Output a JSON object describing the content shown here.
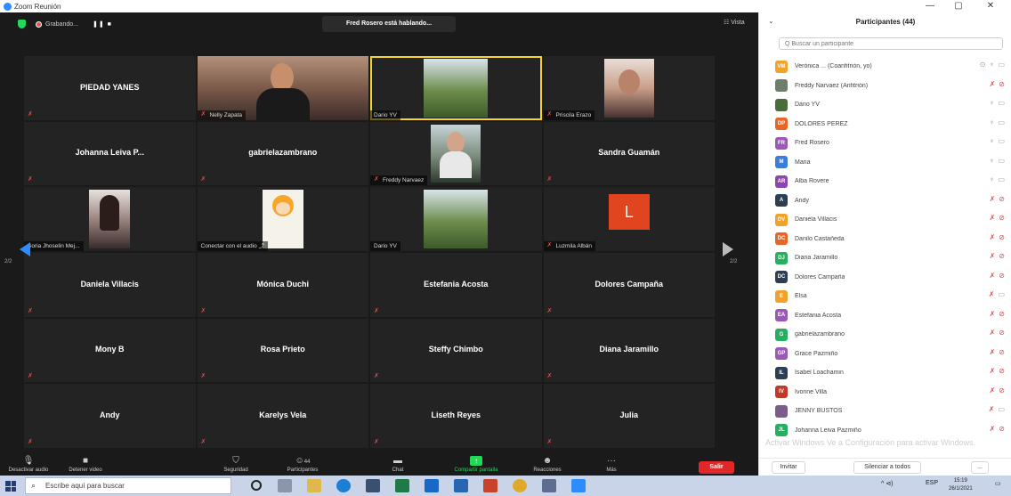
{
  "window": {
    "title": "Zoom Reunión",
    "minimize": "—",
    "maximize": "▢",
    "close": "✕"
  },
  "topbar": {
    "recording_label": "Grabando...",
    "recording_controls": "❚❚ ■",
    "speaking_banner": "Fred Rosero está hablando...",
    "view_label": "☷ Vista"
  },
  "tiles": [
    {
      "name_big": "PIEDAD YANES",
      "label": "",
      "muted": true,
      "video": ""
    },
    {
      "name_big": "",
      "label": "Nelly Zapata",
      "muted": true,
      "video": "nelly"
    },
    {
      "name_big": "",
      "label": "Dario YV",
      "muted": false,
      "video": "dario",
      "speaking": true
    },
    {
      "name_big": "",
      "label": "Priscila Erazo",
      "muted": true,
      "video": "priscila"
    },
    {
      "name_big": "Johanna Leiva P...",
      "label": "",
      "muted": true,
      "video": ""
    },
    {
      "name_big": "gabrielazambrano",
      "label": "",
      "muted": true,
      "video": ""
    },
    {
      "name_big": "",
      "label": "Freddy Narvaez",
      "muted": true,
      "video": "freddy"
    },
    {
      "name_big": "Sandra Guamán",
      "label": "",
      "muted": true,
      "video": ""
    },
    {
      "name_big": "",
      "label": "Soria Jhoselin Mej...",
      "muted": false,
      "video": "soria"
    },
    {
      "name_big": "",
      "label": "Conectar con el audio ⤴",
      "muted": false,
      "video": "naruto"
    },
    {
      "name_big": "",
      "label": "Dario YV",
      "muted": false,
      "video": "dario"
    },
    {
      "name_big": "",
      "label": "Luzmila Albán",
      "muted": true,
      "video": "avatar",
      "avatar_letter": "L"
    },
    {
      "name_big": "Daniela Villacis",
      "label": "",
      "muted": true,
      "video": ""
    },
    {
      "name_big": "Mónica Duchi",
      "label": "",
      "muted": true,
      "video": ""
    },
    {
      "name_big": "Estefania Acosta",
      "label": "",
      "muted": true,
      "video": ""
    },
    {
      "name_big": "Dolores Campaña",
      "label": "",
      "muted": true,
      "video": ""
    },
    {
      "name_big": "Mony B",
      "label": "",
      "muted": true,
      "video": ""
    },
    {
      "name_big": "Rosa Prieto",
      "label": "",
      "muted": true,
      "video": ""
    },
    {
      "name_big": "Steffy Chimbo",
      "label": "",
      "muted": true,
      "video": ""
    },
    {
      "name_big": "Diana Jaramillo",
      "label": "",
      "muted": true,
      "video": ""
    },
    {
      "name_big": "Andy",
      "label": "",
      "muted": true,
      "video": ""
    },
    {
      "name_big": "Karelys Vela",
      "label": "",
      "muted": true,
      "video": ""
    },
    {
      "name_big": "Liseth Reyes",
      "label": "",
      "muted": true,
      "video": ""
    },
    {
      "name_big": "Julia",
      "label": "",
      "muted": true,
      "video": ""
    }
  ],
  "pagination": {
    "left": "2/2",
    "right": "2/2"
  },
  "toolbar": {
    "mute_audio": "Desactivar audio",
    "stop_video": "Detener video",
    "security": "Seguridad",
    "participants": "Participantes",
    "participants_count": "44",
    "chat": "Chat",
    "share_screen": "Compartir pantalla",
    "reactions": "Reacciones",
    "more": "Más",
    "leave": "Salir"
  },
  "panel": {
    "collapse_icon": "⌄",
    "title": "Participantes (44)",
    "search_placeholder": "Q Buscar un participante",
    "participants": [
      {
        "initials": "VM",
        "color": "#f0a22a",
        "name": "Verónica ...  (Coanfitrión, yo)",
        "mic": "on",
        "cam": "on",
        "extra": "⊙"
      },
      {
        "initials": "",
        "color": "#6d7f6a",
        "name": "Freddy Narvaez (Anfitrión)",
        "mic": "muted",
        "cam": "off",
        "photo": true
      },
      {
        "initials": "",
        "color": "#4a6b3a",
        "name": "Dario YV",
        "mic": "on",
        "cam": "on",
        "photo": true
      },
      {
        "initials": "DP",
        "color": "#e8652a",
        "name": "DOLORES PEREZ",
        "mic": "on",
        "cam": "on"
      },
      {
        "initials": "FR",
        "color": "#9b59b6",
        "name": "Fred Rosero",
        "mic": "on",
        "cam": "on"
      },
      {
        "initials": "M",
        "color": "#3b7ddd",
        "name": "Maria",
        "mic": "on",
        "cam": "on"
      },
      {
        "initials": "AR",
        "color": "#8e44ad",
        "name": "Alba Rovere",
        "mic": "on",
        "cam": "on"
      },
      {
        "initials": "A",
        "color": "#2c3e50",
        "name": "Andy",
        "mic": "muted",
        "cam": "off"
      },
      {
        "initials": "DV",
        "color": "#f0a22a",
        "name": "Daniela Villacis",
        "mic": "muted",
        "cam": "off"
      },
      {
        "initials": "DC",
        "color": "#e8652a",
        "name": "Danilo Castañeda",
        "mic": "muted",
        "cam": "off"
      },
      {
        "initials": "DJ",
        "color": "#27ae60",
        "name": "Diana Jaramillo",
        "mic": "muted",
        "cam": "off"
      },
      {
        "initials": "DC",
        "color": "#2c3e50",
        "name": "Dolores Campaña",
        "mic": "muted",
        "cam": "off"
      },
      {
        "initials": "E",
        "color": "#f0a22a",
        "name": "Elsa",
        "mic": "muted",
        "cam": "on"
      },
      {
        "initials": "EA",
        "color": "#9b59b6",
        "name": "Estefania Acosta",
        "mic": "muted",
        "cam": "off"
      },
      {
        "initials": "G",
        "color": "#27ae60",
        "name": "gabrielazambrano",
        "mic": "muted",
        "cam": "off"
      },
      {
        "initials": "GP",
        "color": "#9b59b6",
        "name": "Grace Pazmiño",
        "mic": "muted",
        "cam": "off"
      },
      {
        "initials": "IL",
        "color": "#2c3e50",
        "name": "Isabel Loachamin",
        "mic": "muted",
        "cam": "off"
      },
      {
        "initials": "IV",
        "color": "#c0392b",
        "name": "Ivonne Villa",
        "mic": "muted",
        "cam": "off"
      },
      {
        "initials": "",
        "color": "#7b5d8c",
        "name": "JENNY BUSTOS",
        "mic": "muted",
        "cam": "on",
        "photo": true
      },
      {
        "initials": "JL",
        "color": "#27ae60",
        "name": "Johanna Leiva Pazmiño",
        "mic": "muted",
        "cam": "off"
      }
    ],
    "invite": "Invitar",
    "mute_all": "Silenciar a todos",
    "more": "..."
  },
  "watermark": "Activar Windows  Ve a Configuración para activar Windows.",
  "taskbar": {
    "search_placeholder": "Escribe aquí para buscar",
    "tray_lang": "ESP",
    "tray_icons": "^ ⊲) ",
    "time": "15:19",
    "date": "26/1/2021"
  }
}
